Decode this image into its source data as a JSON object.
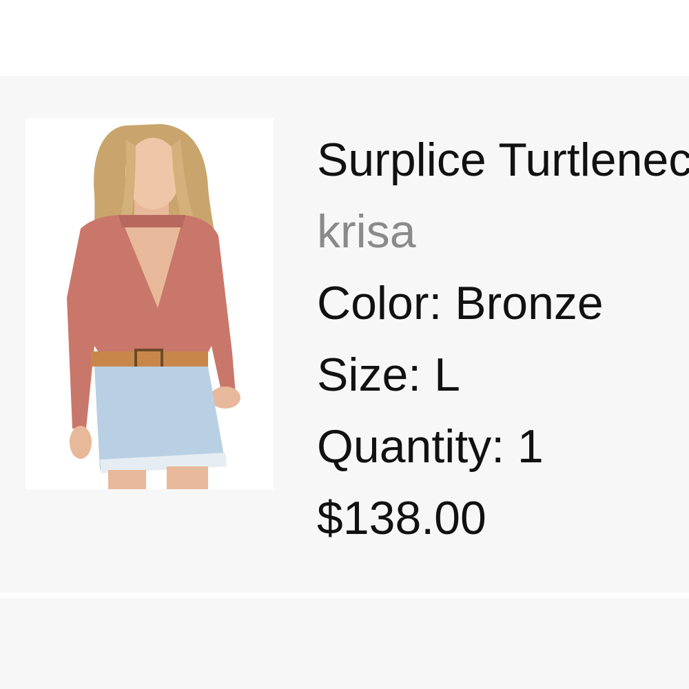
{
  "product": {
    "name": "Surplice Turtleneck",
    "brand": "krisa",
    "color_line": "Color: Bronze",
    "size_line": "Size: L",
    "quantity_line": "Quantity: 1",
    "price": "$138.00",
    "image_icon": "product-photo"
  },
  "colors": {
    "panel_bg": "#f7f7f7",
    "brand_text": "#8a8a8a",
    "primary_text": "#111111",
    "top_color": "#c9776a",
    "denim_color": "#b9d0e4"
  }
}
